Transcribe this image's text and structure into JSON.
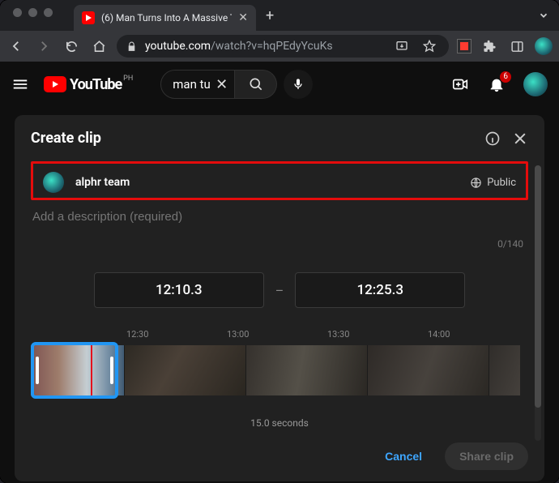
{
  "browser": {
    "tab_title": "(6) Man Turns Into A Massive T",
    "url_domain": "youtube.com",
    "url_rest": "/watch?v=hqPEdyYcuKs"
  },
  "masthead": {
    "logo_word": "YouTube",
    "country_code": "PH",
    "search_value": "man tu",
    "notif_count": "6"
  },
  "panel": {
    "title": "Create clip",
    "owner": "alphr team",
    "visibility": "Public",
    "desc_placeholder": "Add a description (required)",
    "counter": "0/140",
    "start_time": "12:10.3",
    "end_time": "12:25.3",
    "ticks": [
      "12:30",
      "13:00",
      "13:30",
      "14:00"
    ],
    "duration_label": "15.0 seconds",
    "cancel_label": "Cancel",
    "share_label": "Share clip"
  }
}
